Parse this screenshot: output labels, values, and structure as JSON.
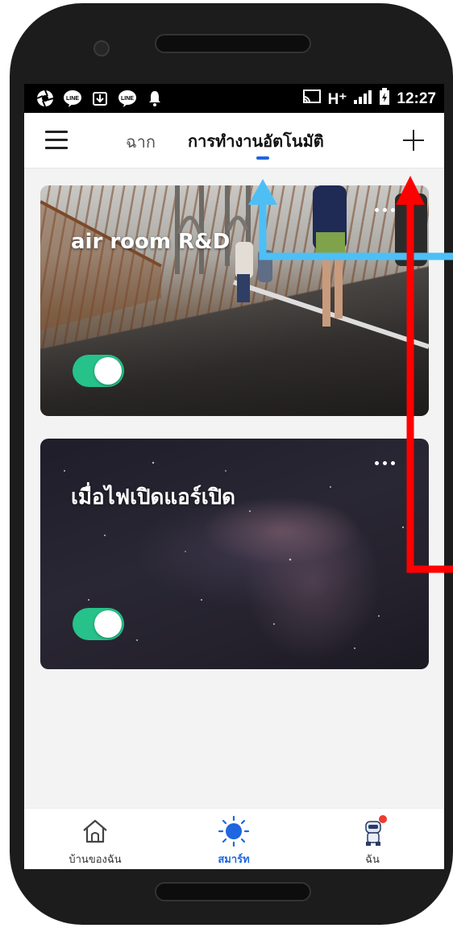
{
  "status_bar": {
    "time": "12:27",
    "network": "H⁺",
    "left_icons": [
      "aperture-icon",
      "line-icon",
      "download-icon",
      "line-icon",
      "bell-icon"
    ],
    "right_icons": [
      "cast-icon",
      "signal-icon",
      "battery-icon"
    ]
  },
  "app_bar": {
    "tabs": [
      {
        "label": "ฉาก",
        "active": false
      },
      {
        "label": "การทำงานอัตโนมัติ",
        "active": true
      }
    ],
    "menu_icon": "hamburger-menu-icon",
    "add_icon": "plus-icon",
    "accent_color": "#1f66e0"
  },
  "cards": [
    {
      "title": "air room R&D",
      "enabled": true,
      "background": "bridge-runners-photo"
    },
    {
      "title": "เมื่อไฟเปิดแอร์เปิด",
      "enabled": true,
      "background": "night-sky-milky-way-photo"
    }
  ],
  "toggle_color": "#26c28a",
  "bottom_nav": {
    "items": [
      {
        "label": "บ้านของฉัน",
        "icon": "home-icon",
        "active": false
      },
      {
        "label": "สมาร์ท",
        "icon": "sun-icon",
        "active": true
      },
      {
        "label": "ฉัน",
        "icon": "robot-avatar-icon",
        "active": false
      }
    ]
  },
  "annotations": {
    "arrow_colors": [
      "#4dbff5",
      "#ff0000"
    ]
  }
}
